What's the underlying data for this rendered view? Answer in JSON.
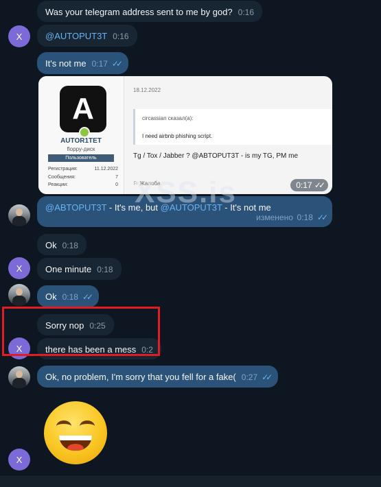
{
  "messages": {
    "m1": {
      "text": "Was your telegram address sent to me by god?",
      "time": "0:16"
    },
    "m2": {
      "text": "@AUTOPUT3T",
      "time": "0:16",
      "avatar": "X"
    },
    "m3": {
      "text": "It's not me",
      "time": "0:17"
    },
    "m4_screenshot": {
      "logo_letter": "A",
      "username": "AUTOR1TET",
      "subtitle": "floppy-диск",
      "role": "Пользователь",
      "stats": [
        {
          "label": "Регистрация:",
          "value": "11.12.2022"
        },
        {
          "label": "Сообщения:",
          "value": "7"
        },
        {
          "label": "Реакции:",
          "value": "0"
        }
      ],
      "date": "18.12.2022",
      "quote_header": "circassian сказал(а):",
      "quote_text": "I need airbnb phishing script.",
      "post_text": "Tg / Tox / Jabber ? @ABTOPUT3T - is my TG, PM me",
      "report": "Жалоба",
      "time": "0:17"
    },
    "m5": {
      "link1": "@ABTOPUT3T",
      "mid": " - It's me, but ",
      "link2": "@AUTOPUT3T",
      "end": " - It's not me",
      "edited": "изменено",
      "time": "0:18"
    },
    "m6": {
      "text": "Ok",
      "time": "0:18"
    },
    "m7": {
      "text": "One minute",
      "time": "0:18",
      "avatar": "X"
    },
    "m8": {
      "text": "Ok",
      "time": "0:18"
    },
    "m9": {
      "text": "Sorry nop",
      "time": "0:25"
    },
    "m10": {
      "text": "there has been a mess",
      "time": "0:2",
      "avatar": "X"
    },
    "m11": {
      "text": "Ok, no problem, I'm sorry that you fell for a fake(",
      "time": "0:27"
    },
    "m12_avatar": "X"
  },
  "watermark": "XSS.is",
  "colors": {
    "incoming": "#182533",
    "outgoing": "#2b5278",
    "background": "#0e1621",
    "highlight": "#e31b23",
    "link": "#6ab2f2"
  }
}
